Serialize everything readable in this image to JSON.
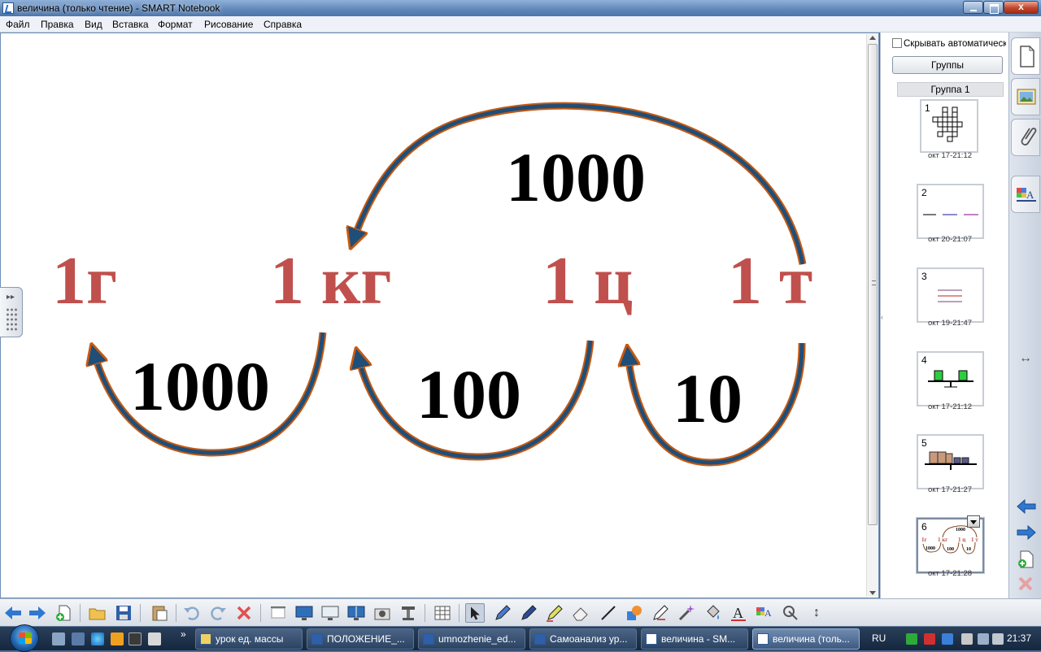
{
  "window": {
    "title": "величина (только чтение) - SMART Notebook",
    "close_glyph": "x"
  },
  "menu": [
    "Файл",
    "Правка",
    "Вид",
    "Вставка",
    "Формат",
    "Рисование",
    "Справка"
  ],
  "canvas": {
    "units": [
      "1г",
      "1 кг",
      "1 ц",
      "1 т"
    ],
    "factors": {
      "top_t_to_kg": "1000",
      "kg_to_g": "1000",
      "c_to_kg": "100",
      "t_to_c": "10"
    },
    "colors": {
      "unit": "#c0504d",
      "arrow_fill": "#1f4e79",
      "arrow_outline": "#c55a11"
    }
  },
  "sorter": {
    "auto_hide_label": "Скрывать автоматическ",
    "groups_button": "Группы",
    "group_header": "Группа 1",
    "pages": [
      {
        "number": "1",
        "date": "окт 17-21:12"
      },
      {
        "number": "2",
        "date": "окт 20-21:07"
      },
      {
        "number": "3",
        "date": "окт 19-21:47"
      },
      {
        "number": "4",
        "date": "окт 17-21:12"
      },
      {
        "number": "5",
        "date": "окт 17-21:27"
      },
      {
        "number": "6",
        "date": "окт 17-21:28"
      }
    ],
    "mini6": {
      "u1": "1г",
      "u2": "1 кг",
      "u3": "1 ц",
      "u4": "1 т",
      "top": "1000",
      "a": "1000",
      "b": "100",
      "c": "10"
    }
  },
  "tabstrip": {
    "icons": [
      "page-sorter-icon",
      "gallery-icon",
      "attachments-icon",
      "properties-icon"
    ],
    "resize_glyph": "↔",
    "nav": [
      "back-arrow-icon",
      "forward-arrow-icon",
      "add-page-icon",
      "delete-page-icon"
    ]
  },
  "taskbar": {
    "more_glyph": "»",
    "tasks": [
      {
        "label": "урок ед. массы",
        "active": false
      },
      {
        "label": "ПОЛОЖЕНИЕ_...",
        "active": false
      },
      {
        "label": "umnozhenie_ed...",
        "active": false
      },
      {
        "label": "Самоанализ ур...",
        "active": false
      },
      {
        "label": "величина - SM...",
        "active": false
      },
      {
        "label": "величина (толь...",
        "active": true
      }
    ],
    "language": "RU",
    "clock": "21:37"
  },
  "toolbar": {
    "resize_glyph": "↕"
  }
}
